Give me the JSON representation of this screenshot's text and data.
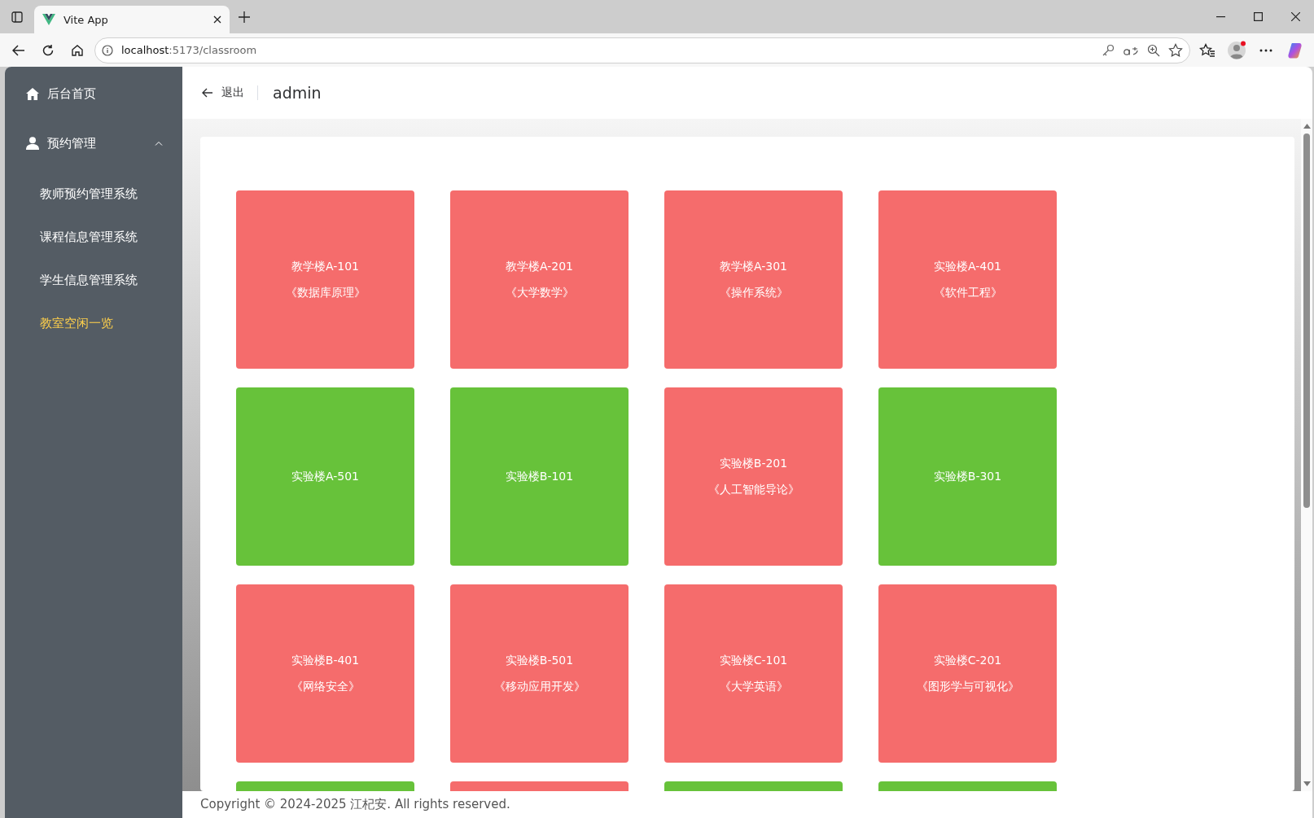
{
  "browser": {
    "tab_title": "Vite App",
    "url_host": "localhost",
    "url_rest": ":5173/classroom"
  },
  "sidebar": {
    "items": [
      {
        "kind": "link",
        "label": "后台首页"
      },
      {
        "kind": "group",
        "label": "预约管理",
        "expanded": true,
        "children": [
          {
            "label": "教师预约管理系统",
            "selected": false
          },
          {
            "label": "课程信息管理系统",
            "selected": false
          },
          {
            "label": "学生信息管理系统",
            "selected": false
          },
          {
            "label": "教室空闲一览",
            "selected": true
          }
        ]
      }
    ]
  },
  "header": {
    "back_label": "退出",
    "user": "admin"
  },
  "classrooms": [
    {
      "color": "#f56c6c",
      "room": "教学楼A-101",
      "course": "《数据库原理》"
    },
    {
      "color": "#f56c6c",
      "room": "教学楼A-201",
      "course": "《大学数学》"
    },
    {
      "color": "#f56c6c",
      "room": "教学楼A-301",
      "course": "《操作系统》"
    },
    {
      "color": "#f56c6c",
      "room": "实验楼A-401",
      "course": "《软件工程》"
    },
    {
      "color": "#67c23a",
      "room": "实验楼A-501"
    },
    {
      "color": "#67c23a",
      "room": "实验楼B-101"
    },
    {
      "color": "#f56c6c",
      "room": "实验楼B-201",
      "course": "《人工智能导论》"
    },
    {
      "color": "#67c23a",
      "room": "实验楼B-301"
    },
    {
      "color": "#f56c6c",
      "room": "实验楼B-401",
      "course": "《网络安全》"
    },
    {
      "color": "#f56c6c",
      "room": "实验楼B-501",
      "course": "《移动应用开发》"
    },
    {
      "color": "#f56c6c",
      "room": "实验楼C-101",
      "course": "《大学英语》"
    },
    {
      "color": "#f56c6c",
      "room": "实验楼C-201",
      "course": "《图形学与可视化》"
    },
    {
      "color": "#67c23a"
    },
    {
      "color": "#f56c6c"
    },
    {
      "color": "#67c23a"
    },
    {
      "color": "#67c23a"
    }
  ],
  "footer": {
    "text": "Copyright © 2024-2025 江杞安. All rights reserved."
  }
}
